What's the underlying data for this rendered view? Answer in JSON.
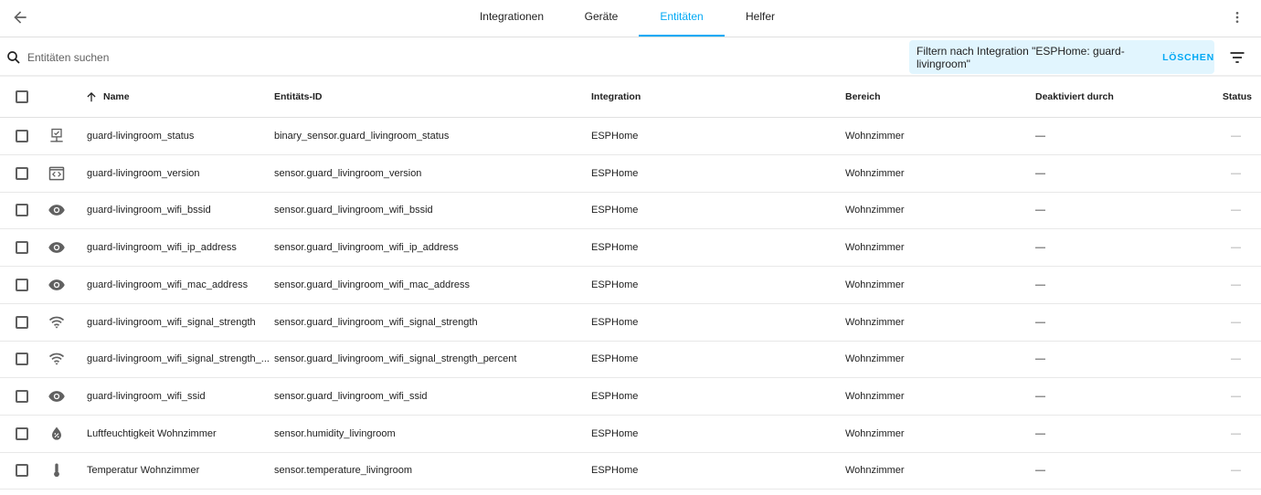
{
  "tabs": [
    {
      "label": "Integrationen"
    },
    {
      "label": "Geräte"
    },
    {
      "label": "Entitäten"
    },
    {
      "label": "Helfer"
    }
  ],
  "search": {
    "placeholder": "Entitäten suchen"
  },
  "filter": {
    "text": "Filtern nach Integration \"ESPHome: guard-livingroom\"",
    "clear_label": "LÖSCHEN"
  },
  "columns": {
    "name": "Name",
    "id": "Entitäts-ID",
    "integration": "Integration",
    "area": "Bereich",
    "disabled": "Deaktiviert durch",
    "status": "Status"
  },
  "rows": [
    {
      "icon": "monitor-check",
      "name": "guard-livingroom_status",
      "id": "binary_sensor.guard_livingroom_status",
      "integration": "ESPHome",
      "area": "Wohnzimmer",
      "disabled": "—",
      "status": "—"
    },
    {
      "icon": "code-window",
      "name": "guard-livingroom_version",
      "id": "sensor.guard_livingroom_version",
      "integration": "ESPHome",
      "area": "Wohnzimmer",
      "disabled": "—",
      "status": "—"
    },
    {
      "icon": "eye",
      "name": "guard-livingroom_wifi_bssid",
      "id": "sensor.guard_livingroom_wifi_bssid",
      "integration": "ESPHome",
      "area": "Wohnzimmer",
      "disabled": "—",
      "status": "—"
    },
    {
      "icon": "eye",
      "name": "guard-livingroom_wifi_ip_address",
      "id": "sensor.guard_livingroom_wifi_ip_address",
      "integration": "ESPHome",
      "area": "Wohnzimmer",
      "disabled": "—",
      "status": "—"
    },
    {
      "icon": "eye",
      "name": "guard-livingroom_wifi_mac_address",
      "id": "sensor.guard_livingroom_wifi_mac_address",
      "integration": "ESPHome",
      "area": "Wohnzimmer",
      "disabled": "—",
      "status": "—"
    },
    {
      "icon": "wifi",
      "name": "guard-livingroom_wifi_signal_strength",
      "id": "sensor.guard_livingroom_wifi_signal_strength",
      "integration": "ESPHome",
      "area": "Wohnzimmer",
      "disabled": "—",
      "status": "—"
    },
    {
      "icon": "wifi",
      "name": "guard-livingroom_wifi_signal_strength_...",
      "id": "sensor.guard_livingroom_wifi_signal_strength_percent",
      "integration": "ESPHome",
      "area": "Wohnzimmer",
      "disabled": "—",
      "status": "—"
    },
    {
      "icon": "eye",
      "name": "guard-livingroom_wifi_ssid",
      "id": "sensor.guard_livingroom_wifi_ssid",
      "integration": "ESPHome",
      "area": "Wohnzimmer",
      "disabled": "—",
      "status": "—"
    },
    {
      "icon": "water-percent",
      "name": "Luftfeuchtigkeit Wohnzimmer",
      "id": "sensor.humidity_livingroom",
      "integration": "ESPHome",
      "area": "Wohnzimmer",
      "disabled": "—",
      "status": "—"
    },
    {
      "icon": "thermometer",
      "name": "Temperatur Wohnzimmer",
      "id": "sensor.temperature_livingroom",
      "integration": "ESPHome",
      "area": "Wohnzimmer",
      "disabled": "—",
      "status": "—"
    }
  ],
  "colors": {
    "accent": "#03a9f4",
    "chip_bg": "#e1f5fe"
  }
}
